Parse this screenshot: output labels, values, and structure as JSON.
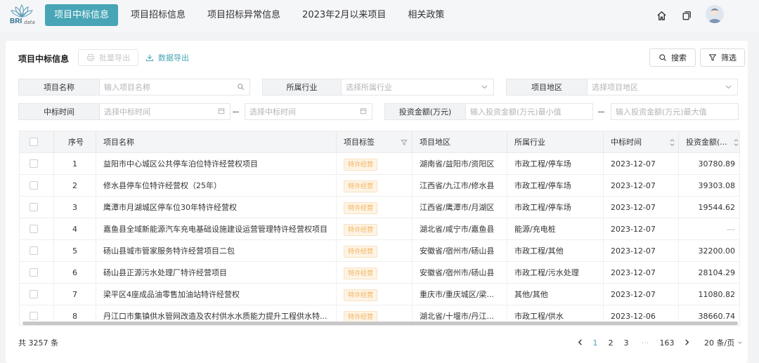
{
  "logo": {
    "text": "BRI",
    "sub": "data"
  },
  "nav": [
    {
      "label": "项目中标信息",
      "active": true
    },
    {
      "label": "项目招标信息",
      "active": false
    },
    {
      "label": "项目招标异常信息",
      "active": false
    },
    {
      "label": "2023年2月以来项目",
      "active": false
    },
    {
      "label": "相关政策",
      "active": false
    }
  ],
  "topIcons": [
    "home-icon",
    "copy-icon",
    "user-avatar"
  ],
  "card": {
    "title": "项目中标信息",
    "batchExport": "批量导出",
    "dataExport": "数据导出",
    "search": "搜索",
    "filter": "筛选"
  },
  "filters": {
    "projectName": {
      "label": "项目名称",
      "placeholder": "输入项目名称"
    },
    "industry": {
      "label": "所属行业",
      "placeholder": "选择所属行业"
    },
    "region": {
      "label": "项目地区",
      "placeholder": "选择项目地区"
    },
    "bidTime": {
      "label": "中标时间",
      "start": "选择中标时间",
      "end": "选择中标时间"
    },
    "investment": {
      "label": "投资金额(万元)",
      "min": "输入投资金额(万元)最小值",
      "max": "输入投资金额(万元)最大值"
    }
  },
  "table": {
    "headers": {
      "index": "序号",
      "name": "项目名称",
      "tag": "项目标签",
      "region": "项目地区",
      "industry": "所属行业",
      "time": "中标时间",
      "amount": "投资金额(..."
    },
    "rows": [
      {
        "index": "1",
        "name": "益阳市中心城区公共停车泊位特许经营权项目",
        "tag": "特许经营",
        "region": "湖南省/益阳市/资阳区",
        "industry": "市政工程/停车场",
        "time": "2023-12-07",
        "amount": "30780.89"
      },
      {
        "index": "2",
        "name": "修水县停车位特许经营权（25年）",
        "tag": "特许经营",
        "region": "江西省/九江市/修水县",
        "industry": "市政工程/停车场",
        "time": "2023-12-07",
        "amount": "39303.08"
      },
      {
        "index": "3",
        "name": "鹰潭市月湖城区停车位30年特许经营权",
        "tag": "特许经营",
        "region": "江西省/鹰潭市/月湖区",
        "industry": "市政工程/停车场",
        "time": "2023-12-07",
        "amount": "19544.62"
      },
      {
        "index": "4",
        "name": "嘉鱼县全域新能源汽车充电基础设施建设运营管理特许经营权项目",
        "tag": "特许经营",
        "region": "湖北省/咸宁市/嘉鱼县",
        "industry": "能源/充电桩",
        "time": "2023-12-07",
        "amount": "---"
      },
      {
        "index": "5",
        "name": "砀山县城市管家服务特许经营项目二包",
        "tag": "特许经营",
        "region": "安徽省/宿州市/砀山县",
        "industry": "市政工程/其他",
        "time": "2023-12-07",
        "amount": "32200.00"
      },
      {
        "index": "6",
        "name": "砀山县正源污水处理厂特许经营项目",
        "tag": "特许经营",
        "region": "安徽省/宿州市/砀山县",
        "industry": "市政工程/污水处理",
        "time": "2023-12-07",
        "amount": "28104.29"
      },
      {
        "index": "7",
        "name": "梁平区4座成品油零售加油站特许经营权",
        "tag": "特许经营",
        "region": "重庆市/重庆城区/梁...",
        "industry": "其他/其他",
        "time": "2023-12-07",
        "amount": "11080.82"
      },
      {
        "index": "8",
        "name": "丹江口市集镇供水管网改造及农村供水水质能力提升工程供水特...",
        "tag": "特许经营",
        "region": "湖北省/十堰市/丹江...",
        "industry": "市政工程/供水",
        "time": "2023-12-06",
        "amount": "38660.74"
      }
    ]
  },
  "footer": {
    "total": "共 3257 条",
    "pages": [
      "1",
      "2",
      "3",
      "···",
      "163"
    ],
    "currentPage": "1",
    "pageSize": "20 条/页"
  },
  "colors": {
    "accent": "#47a5b6",
    "tagText": "#f3b35a",
    "tagBg": "#fdf4e6"
  }
}
